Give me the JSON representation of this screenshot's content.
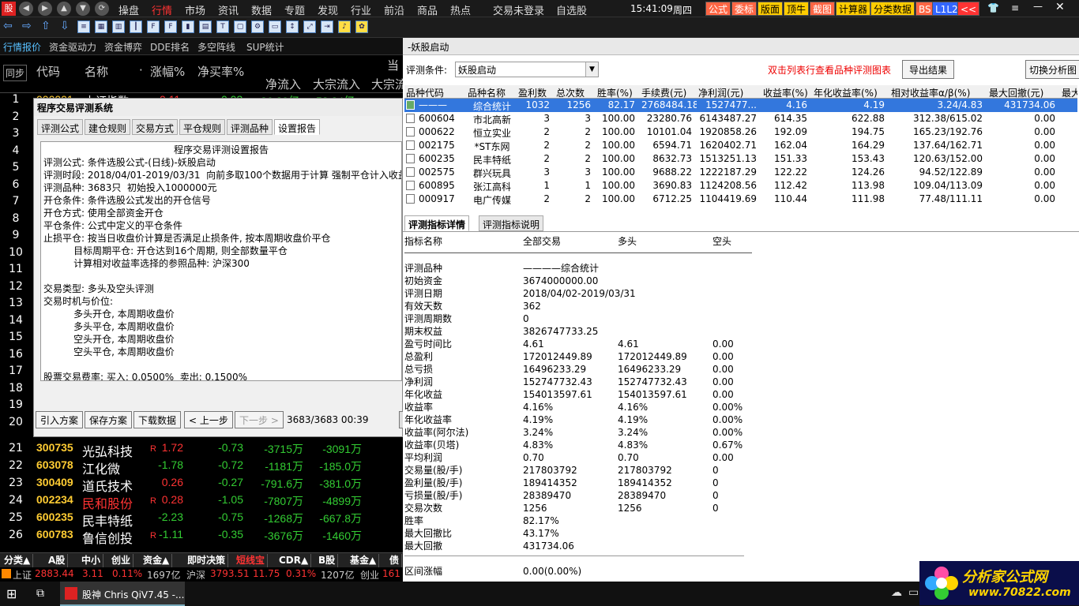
{
  "menu": {
    "items": [
      "操盘",
      "行情",
      "市场",
      "资讯",
      "数据",
      "专题",
      "发现",
      "行业",
      "前沿",
      "商品",
      "热点"
    ],
    "active_index": 1,
    "status": "交易未登录",
    "watch": "自选股",
    "time": "15:41:09",
    "weekday": "周四",
    "right_buttons": [
      "公式",
      "委标",
      "版面",
      "顶牛",
      "截图",
      "计算器",
      "分类数据",
      "BS",
      "L1L2",
      "<<"
    ]
  },
  "left_tabs": [
    "行情报价",
    "资金驱动力",
    "资金博弈",
    "DDE排名",
    "多空阵线",
    "SUP统计"
  ],
  "columns": {
    "sync": "同步",
    "code": "代码",
    "name": "名称",
    "dot": "·",
    "change_pct": "涨幅%",
    "net_buy": "净买率%",
    "current": "当",
    "net_inflow": "净流入",
    "big_inflow": "大宗流入",
    "big_flow": "大宗流"
  },
  "row_numbers": [
    "1",
    "2",
    "3",
    "4",
    "5",
    "6",
    "7",
    "8",
    "9",
    "10",
    "11",
    "12",
    "13",
    "14",
    "15",
    "16",
    "17",
    "18",
    "19",
    "20"
  ],
  "partial_row": {
    "code": "000001",
    "name": "上证指数",
    "change": "0.11",
    "net_buy": "0.03",
    "net_inflow": "86.39亿",
    "big": "52.84亿"
  },
  "stocks": [
    {
      "num": "21",
      "code": "300735",
      "name": "光弘科技",
      "flag": "R",
      "change": "1.72",
      "net_buy": "-0.73",
      "net_inflow": "-3715万",
      "big": "-3091万",
      "name_color": "#ffffff"
    },
    {
      "num": "22",
      "code": "603078",
      "name": "江化微",
      "flag": "",
      "change": "-1.78",
      "net_buy": "-0.72",
      "net_inflow": "-1181万",
      "big": "-185.0万",
      "name_color": "#ffffff"
    },
    {
      "num": "23",
      "code": "300409",
      "name": "道氏技术",
      "flag": "",
      "change": "0.26",
      "net_buy": "-0.27",
      "net_inflow": "-791.6万",
      "big": "-381.0万",
      "name_color": "#ffffff"
    },
    {
      "num": "24",
      "code": "002234",
      "name": "民和股份",
      "flag": "R",
      "change": "0.28",
      "net_buy": "-1.05",
      "net_inflow": "-7807万",
      "big": "-4899万",
      "name_color": "#ff3333"
    },
    {
      "num": "25",
      "code": "600235",
      "name": "民丰特纸",
      "flag": "",
      "change": "-2.23",
      "net_buy": "-0.75",
      "net_inflow": "-1268万",
      "big": "-667.8万",
      "name_color": "#ffffff"
    },
    {
      "num": "26",
      "code": "600783",
      "name": "鲁信创投",
      "flag": "R",
      "change": "-1.11",
      "net_buy": "-0.35",
      "net_inflow": "-3676万",
      "big": "-1460万",
      "name_color": "#ffffff"
    }
  ],
  "bottom_tabs": [
    "分类▲",
    "A股",
    "中小",
    "创业",
    "资金▲",
    "即时决策",
    "短线宝",
    "CDR▲",
    "B股",
    "基金▲",
    "债"
  ],
  "index_bar": {
    "sh_name": "上证",
    "sh_value": "2883.44",
    "sh_change": "3.11",
    "sh_pct": "0.11%",
    "sh_amount": "1697亿",
    "sz_name": "沪深",
    "sz_value": "3793.51",
    "sz_change": "11.75",
    "sz_pct": "0.31%",
    "sz_amount": "1207亿",
    "cy_name": "创业",
    "cy_value": "161"
  },
  "dialog": {
    "title": "程序交易评测系统",
    "tabs": [
      "评测公式",
      "建仓规则",
      "交易方式",
      "平仓规则",
      "评测品种",
      "设置报告"
    ],
    "report_title": "程序交易评测设置报告",
    "report_lines": [
      "评测公式: 条件选股公式-(日线)-妖股启动",
      "评测时段: 2018/04/01-2019/03/31  向前多取100个数据用于计算 强制平仓计入收益",
      "评测品种: 3683只  初始投入1000000元",
      "开仓条件: 条件选股公式发出的开仓信号",
      "开仓方式: 使用全部资金开仓",
      "平仓条件: 公式中定义的平仓条件",
      "止损平仓: 按当日收盘价计算是否满足止损条件, 按本周期收盘价平仓",
      "          目标周期平仓: 开仓达到16个周期, 则全部数量平仓",
      "          计算相对收益率选择的参照品种: 沪深300",
      "",
      "交易类型: 多头及空头评测",
      "交易时机与价位:",
      "          多头开仓, 本周期收盘价",
      "          多头平仓, 本周期收盘价",
      "          空头开仓, 本周期收盘价",
      "          空头平仓, 本周期收盘价",
      "",
      "股票交易费率: 买入: 0.0500%  卖出: 0.1500%"
    ],
    "buttons": [
      "引入方案",
      "保存方案",
      "下载数据",
      "< 上一步",
      "下一步 >"
    ],
    "progress": "3683/3683 00:39"
  },
  "panel": {
    "title": "-妖股启动",
    "cond_label": "评测条件:",
    "cond_value": "妖股启动",
    "hint": "双击列表行查看品种评测图表",
    "export_btn": "导出结果",
    "switch_btn": "切换分析图",
    "headers": [
      "品种代码",
      "品种名称",
      "盈利数",
      "总次数",
      "胜率(%)",
      "手续费(元)",
      "净利润(元)",
      "收益率(%)",
      "年化收益率(%)",
      "相对收益率α/β(%)",
      "最大回撤(元)",
      "最大"
    ],
    "rows": [
      [
        "———",
        "综合统计",
        "1032",
        "1256",
        "82.17",
        "2768484.18",
        "1527477...",
        "4.16",
        "4.19",
        "3.24/4.83",
        "431734.06"
      ],
      [
        "600604",
        "市北高新",
        "3",
        "3",
        "100.00",
        "23280.76",
        "6143487.27",
        "614.35",
        "622.88",
        "312.38/615.02",
        "0.00"
      ],
      [
        "000622",
        "恒立实业",
        "2",
        "2",
        "100.00",
        "10101.04",
        "1920858.26",
        "192.09",
        "194.75",
        "165.23/192.76",
        "0.00"
      ],
      [
        "002175",
        "*ST东网",
        "2",
        "2",
        "100.00",
        "6594.71",
        "1620402.71",
        "162.04",
        "164.29",
        "137.64/162.71",
        "0.00"
      ],
      [
        "600235",
        "民丰特纸",
        "2",
        "2",
        "100.00",
        "8632.73",
        "1513251.13",
        "151.33",
        "153.43",
        "120.63/152.00",
        "0.00"
      ],
      [
        "002575",
        "群兴玩具",
        "3",
        "3",
        "100.00",
        "9688.22",
        "1222187.29",
        "122.22",
        "124.26",
        "94.52/122.89",
        "0.00"
      ],
      [
        "600895",
        "张江高科",
        "1",
        "1",
        "100.00",
        "3690.83",
        "1124208.56",
        "112.42",
        "113.98",
        "109.04/113.09",
        "0.00"
      ],
      [
        "000917",
        "电广传媒",
        "2",
        "2",
        "100.00",
        "6712.25",
        "1104419.69",
        "110.44",
        "111.98",
        "77.48/111.11",
        "0.00"
      ]
    ],
    "detail_tabs": [
      "评测指标详情",
      "评测指标说明"
    ],
    "detail_headers": [
      "指标名称",
      "全部交易",
      "多头",
      "空头"
    ],
    "details": [
      [
        "评测品种",
        "————综合统计",
        "",
        ""
      ],
      [
        "初始资金",
        "3674000000.00",
        "",
        ""
      ],
      [
        "评测日期",
        "2018/04/02-2019/03/31",
        "",
        ""
      ],
      [
        "有效天数",
        "362",
        "",
        ""
      ],
      [
        "评测周期数",
        "0",
        "",
        ""
      ],
      [
        "期末权益",
        "3826747733.25",
        "",
        ""
      ],
      [
        "盈亏时间比",
        "4.61",
        "4.61",
        "0.00"
      ],
      [
        "总盈利",
        "172012449.89",
        "172012449.89",
        "0.00"
      ],
      [
        "总亏损",
        "16496233.29",
        "16496233.29",
        "0.00"
      ],
      [
        "净利润",
        "152747732.43",
        "152747732.43",
        "0.00"
      ],
      [
        "年化收益",
        "154013597.61",
        "154013597.61",
        "0.00"
      ],
      [
        "收益率",
        "4.16%",
        "4.16%",
        "0.00%"
      ],
      [
        "年化收益率",
        "4.19%",
        "4.19%",
        "0.00%"
      ],
      [
        "收益率(阿尔法)",
        "3.24%",
        "3.24%",
        "0.00%"
      ],
      [
        "收益率(贝塔)",
        "4.83%",
        "4.83%",
        "0.67%"
      ],
      [
        "平均利润",
        "0.70",
        "0.70",
        "0.00"
      ],
      [
        "交易量(股/手)",
        "217803792",
        "217803792",
        "0"
      ],
      [
        "盈利量(股/手)",
        "189414352",
        "189414352",
        "0"
      ],
      [
        "亏损量(股/手)",
        "28389470",
        "28389470",
        "0"
      ],
      [
        "交易次数",
        "1256",
        "1256",
        "0"
      ],
      [
        "胜率",
        "82.17%",
        "",
        ""
      ],
      [
        "最大回撤比",
        "43.17%",
        "",
        ""
      ],
      [
        "最大回撤",
        "431734.06",
        "",
        ""
      ],
      [
        "",
        "",
        " ",
        ""
      ],
      [
        "区间涨幅",
        "0.00(0.00%)",
        "",
        ""
      ]
    ]
  },
  "taskbar": {
    "app": "股神 Chris QiV7.45 -...",
    "watermark_text": "分析家公式网",
    "watermark_url": "www.70822.com"
  }
}
